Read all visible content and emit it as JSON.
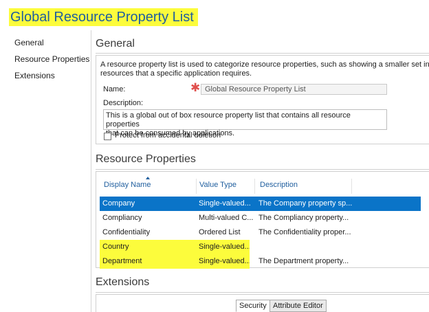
{
  "page": {
    "title": "Global Resource Property List"
  },
  "nav": {
    "items": [
      "General",
      "Resource Properties",
      "Extensions"
    ]
  },
  "general": {
    "heading": "General",
    "description_line1": "A resource property list is used to categorize resource properties, such as showing a smaller set in a clas",
    "description_line2": "resources that a specific application requires.",
    "name_label": "Name:",
    "name_value": "Global Resource Property List",
    "description_label": "Description:",
    "description_value_line1": "This is a global out of box resource property list that contains all resource properties",
    "description_value_line2": "that can be consumed by applications.",
    "protect_label": "Protect from accidental deletion"
  },
  "resource_properties": {
    "heading": "Resource Properties",
    "columns": [
      "Display Name",
      "Value Type",
      "Description"
    ],
    "rows": [
      {
        "name": "Company",
        "type": "Single-valued...",
        "description": "The Company property sp..."
      },
      {
        "name": "Compliancy",
        "type": "Multi-valued C...",
        "description": "The Compliancy property..."
      },
      {
        "name": "Confidentiality",
        "type": "Ordered List",
        "description": "The Confidentiality proper..."
      },
      {
        "name": "Country",
        "type": "Single-valued...",
        "description": ""
      },
      {
        "name": "Department",
        "type": "Single-valued...",
        "description": "The Department property..."
      }
    ]
  },
  "extensions": {
    "heading": "Extensions",
    "tabs": [
      "Security",
      "Attribute Editor"
    ]
  },
  "colors": {
    "selection": "#0a74c8",
    "highlight": "#fcfc3c",
    "title": "#1f5e9e"
  }
}
